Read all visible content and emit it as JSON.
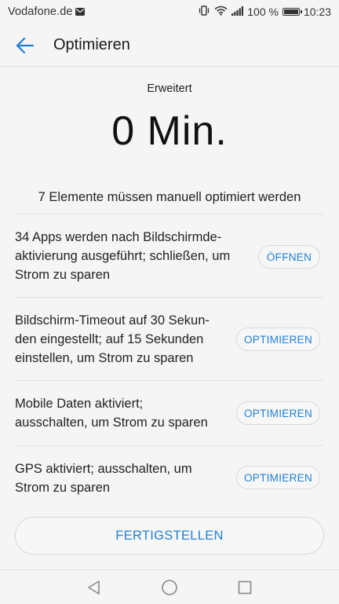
{
  "status_bar": {
    "carrier": "Vodafone.de",
    "battery": "100 %",
    "time": "10:23",
    "icons": [
      "mail-icon",
      "vibrate-icon",
      "wifi-icon",
      "signal-icon",
      "battery-icon"
    ]
  },
  "app_bar": {
    "title": "Optimieren",
    "back_icon": "back-arrow-icon",
    "accent_color": "#1e7fd6"
  },
  "summary": {
    "mode_label": "Erweitert",
    "time_value": "0 Min.",
    "issues_text": "7 Elemente müssen manuell optimiert werden"
  },
  "items": [
    {
      "lines": [
        "34 Apps werden nach Bildschirmde-",
        "aktivierung ausgeführt; schließen, um",
        "Strom zu sparen"
      ],
      "button": "ÖFFNEN"
    },
    {
      "lines": [
        "Bildschirm-Timeout auf 30 Sekun-",
        "den eingestellt; auf 15 Sekunden",
        "einstellen, um Strom zu sparen"
      ],
      "button": "OPTIMIEREN"
    },
    {
      "lines": [
        "Mobile Daten aktiviert;",
        "ausschalten, um Strom zu sparen"
      ],
      "button": "OPTIMIEREN"
    },
    {
      "lines": [
        "GPS aktiviert; ausschalten, um",
        "Strom zu sparen"
      ],
      "button": "OPTIMIEREN"
    }
  ],
  "finish_button": "FERTIGSTELLEN",
  "nav_bar": {
    "icons": [
      "back-triangle-icon",
      "home-circle-icon",
      "recents-square-icon"
    ]
  }
}
